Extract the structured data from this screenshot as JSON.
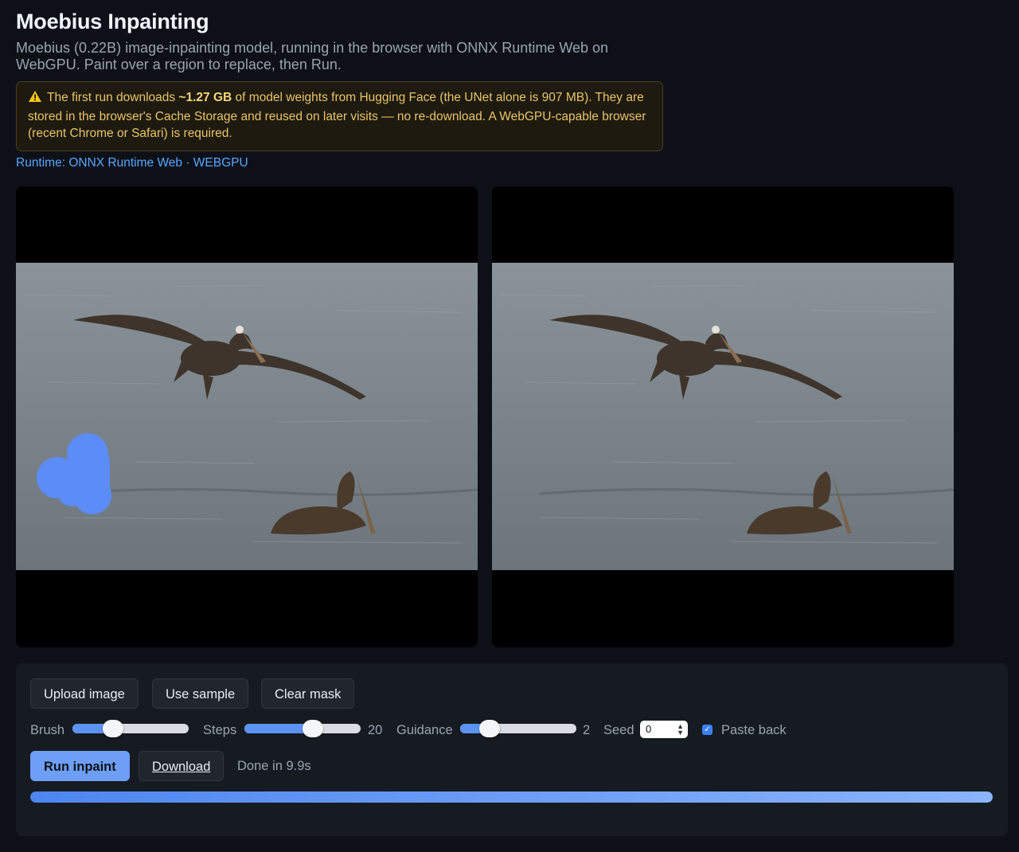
{
  "header": {
    "title": "Moebius Inpainting",
    "subtitle": "Moebius (0.22B) image-inpainting model, running in the browser with ONNX Runtime Web on WebGPU. Paint over a region to replace, then Run."
  },
  "warning": {
    "icon": "warning-icon",
    "text_before": "The first run downloads",
    "size": "~1.27 GB",
    "text_after": "of model weights from Hugging Face (the UNet alone is 907 MB). They are stored in the browser's Cache Storage and reused on later visits — no re-download. A WebGPU-capable browser (recent Chrome or Safari) is required."
  },
  "runtime": "Runtime: ONNX Runtime Web · WEBGPU",
  "controls": {
    "upload_label": "Upload image",
    "sample_label": "Use sample",
    "clear_label": "Clear mask",
    "brush_label": "Brush",
    "brush_level": 0.35,
    "steps_label": "Steps",
    "steps_value": "20",
    "steps_level": 0.59,
    "guidance_label": "Guidance",
    "guidance_value": "2",
    "guidance_level": 0.25,
    "seed_label": "Seed",
    "seed_value": "0",
    "paste_back_label": "Paste back",
    "paste_back_checked": true,
    "run_label": "Run inpaint",
    "download_label": "Download",
    "status": "Done in 9.9s",
    "progress": 1.0
  },
  "colors": {
    "accent": "#6e9ff7",
    "mask": "#5b8cf7",
    "warning_text": "#e9c46a"
  }
}
